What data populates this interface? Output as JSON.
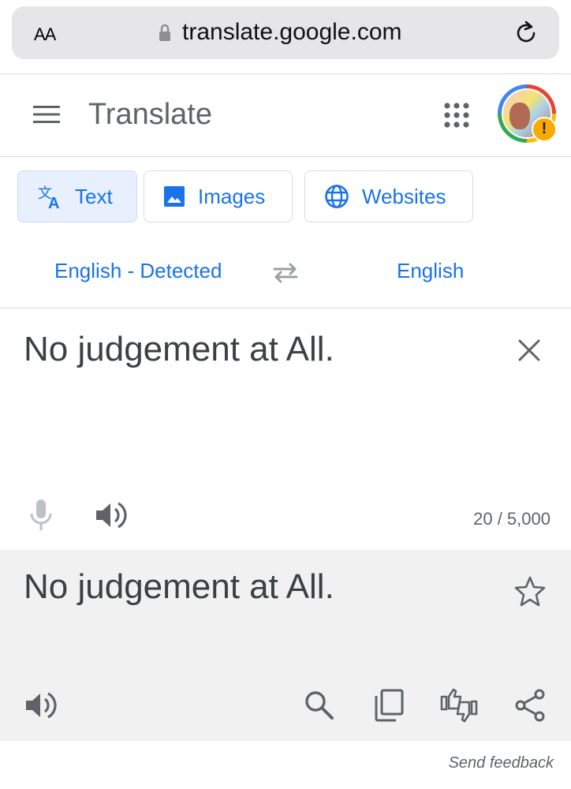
{
  "browser": {
    "text_size_label": "AA",
    "url": "translate.google.com",
    "lock_icon": "lock-icon",
    "reload_icon": "reload-icon"
  },
  "header": {
    "title": "Translate",
    "menu_icon": "menu-icon",
    "apps_icon": "apps-grid-icon",
    "avatar_badge": "!"
  },
  "tabs": [
    {
      "label": "Text",
      "icon": "translate-icon",
      "active": true
    },
    {
      "label": "Images",
      "icon": "image-icon",
      "active": false
    },
    {
      "label": "Websites",
      "icon": "globe-icon",
      "active": false
    }
  ],
  "languages": {
    "source": "English - Detected",
    "target": "English",
    "swap_icon": "swap-icon"
  },
  "source": {
    "text": "No judgement at All.",
    "char_count": "20 / 5,000"
  },
  "target": {
    "text": "No judgement at All."
  },
  "footer": {
    "feedback": "Send feedback"
  },
  "colors": {
    "accent": "#1a73e8",
    "text": "#3c4043",
    "secondary": "#5f6368",
    "target_bg": "#f1f1f1",
    "active_tab_bg": "#e8f0fe"
  }
}
